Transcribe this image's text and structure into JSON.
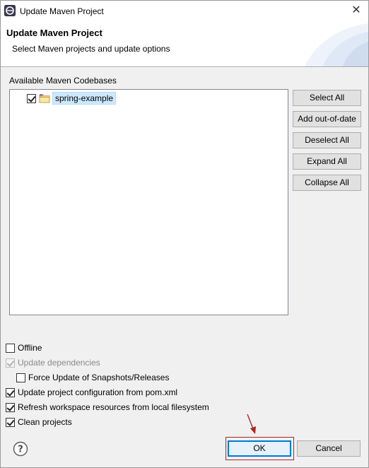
{
  "window": {
    "title": "Update Maven Project"
  },
  "banner": {
    "title": "Update Maven Project",
    "description": "Select Maven projects and update options"
  },
  "codebases": {
    "label": "Available Maven Codebases",
    "items": [
      {
        "label": "spring-example",
        "checked": true
      }
    ]
  },
  "side_buttons": {
    "select_all": "Select All",
    "add_out_of_date": "Add out-of-date",
    "deselect_all": "Deselect All",
    "expand_all": "Expand All",
    "collapse_all": "Collapse All"
  },
  "options": {
    "offline": {
      "label": "Offline",
      "checked": false,
      "enabled": true
    },
    "update_dependencies": {
      "label": "Update dependencies",
      "checked": true,
      "enabled": false
    },
    "force_update": {
      "label": "Force Update of Snapshots/Releases",
      "checked": false,
      "enabled": true
    },
    "update_config": {
      "label": "Update project configuration from pom.xml",
      "checked": true,
      "enabled": true
    },
    "refresh_workspace": {
      "label": "Refresh workspace resources from local filesystem",
      "checked": true,
      "enabled": true
    },
    "clean_projects": {
      "label": "Clean projects",
      "checked": true,
      "enabled": true
    }
  },
  "footer": {
    "ok_label": "OK",
    "cancel_label": "Cancel"
  },
  "icons": {
    "app": "eclipse-icon",
    "close": "close-icon",
    "help": "help-icon",
    "folder": "maven-project-folder-icon",
    "annotation": "red-arrow-icon"
  },
  "colors": {
    "selection": "#cce8ff",
    "default_button_border": "#0078d7",
    "annotation": "#b22222"
  }
}
